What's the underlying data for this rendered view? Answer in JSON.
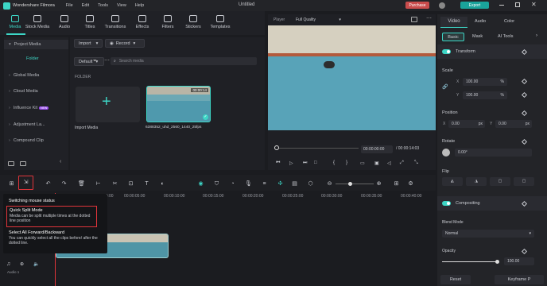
{
  "app": {
    "brand": "Wondershare Filmora",
    "title": "Untitled",
    "menu": [
      "File",
      "Edit",
      "Tools",
      "View",
      "Help"
    ],
    "purchase": "Purchase",
    "export": "Export"
  },
  "toolbar": {
    "items": [
      "Media",
      "Stock Media",
      "Audio",
      "Titles",
      "Transitions",
      "Effects",
      "Filters",
      "Stickers",
      "Templates"
    ]
  },
  "sidebar": {
    "items": [
      "Project Media",
      "Folder",
      "Global Media",
      "Cloud Media",
      "Influence Kit",
      "Adjustment La...",
      "Compound Clip"
    ],
    "badge": "NEW"
  },
  "media": {
    "import_label": "Import",
    "record_label": "Record",
    "sort_label": "Default",
    "search_placeholder": "Search media",
    "folder_label": "FOLDER",
    "import_card": "Import Media",
    "clip_name": "6388352_uhd_2560_1440_25fps",
    "clip_duration": "00:00:14"
  },
  "player": {
    "label": "Player",
    "quality": "Full Quality",
    "current_time": "00:00:00:00",
    "total_time": "00:00:14:03"
  },
  "right_panel": {
    "tabs": [
      "Video",
      "Audio",
      "Color"
    ],
    "subtabs": [
      "Basic",
      "Mask",
      "AI Tools"
    ],
    "transform": "Transform",
    "scale": {
      "label": "Scale",
      "x_label": "X",
      "x_value": "100.00",
      "y_label": "Y",
      "y_value": "100.00",
      "unit": "%"
    },
    "position": {
      "label": "Position",
      "x_label": "X",
      "x_value": "0.00",
      "y_label": "Y",
      "y_value": "0.00",
      "unit": "px"
    },
    "rotate": {
      "label": "Rotate",
      "value": "0.00°"
    },
    "flip": "Flip",
    "compositing": "Compositing",
    "blend_mode": {
      "label": "Blend Mode",
      "value": "Normal"
    },
    "opacity": {
      "label": "Opacity",
      "value": "100.00",
      "level": 1.0
    },
    "reset": "Reset",
    "keyframe": "Keyframe P"
  },
  "timeline": {
    "ruler": [
      "00:00",
      "00:00:05:00",
      "00:00:10:00",
      "00:00:15:00",
      "00:00:20:00",
      "00:00:25:00",
      "00:00:30:00",
      "00:00:35:00",
      "00:00:40:00",
      "00:00:45:00"
    ],
    "audio_track": "Audio 1",
    "tooltip": {
      "title": "Switching mouse status",
      "quick_split_title": "Quick Split Mode",
      "quick_split_desc": "Media can be split multiple times at the dotted line position",
      "select_all_title": "Select All Forward/Backward",
      "select_all_desc": "You can quickly select all the clips before/ after the dotted line."
    }
  },
  "colors": {
    "accent": "#3dd6c6",
    "purchase": "#c94c4c",
    "export": "#1aa39a",
    "highlight": "#e0343a"
  }
}
